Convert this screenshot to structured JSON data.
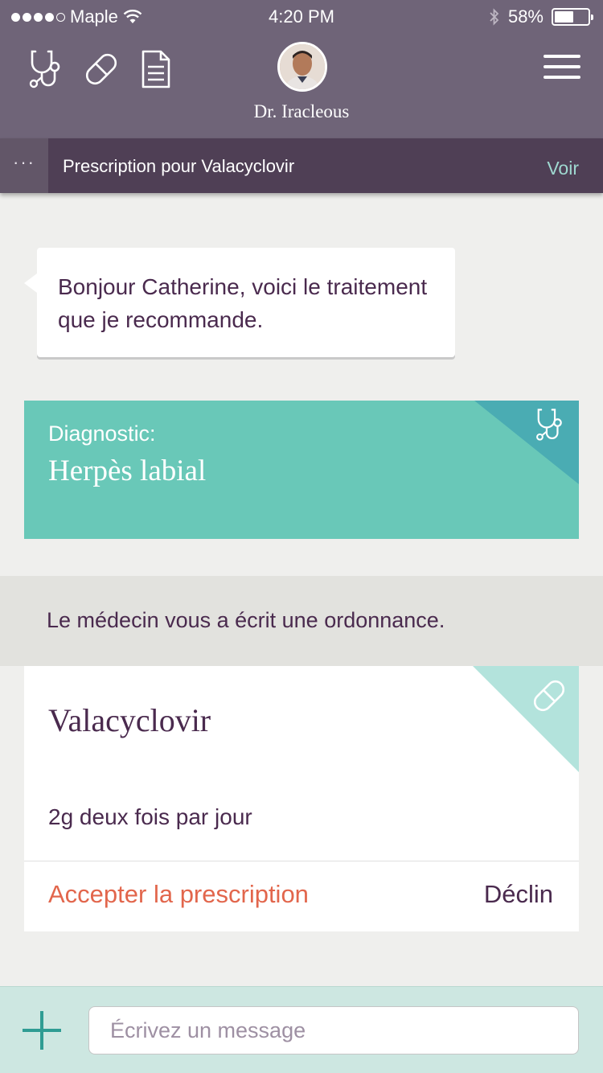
{
  "status_bar": {
    "carrier": "Maple",
    "time": "4:20 PM",
    "battery_percent": "58%",
    "battery_level": 0.58,
    "signal_bars_filled": 4
  },
  "header": {
    "doctor_name": "Dr. Iracleous",
    "icons": [
      "stethoscope-icon",
      "pill-icon",
      "document-icon",
      "menu-icon"
    ]
  },
  "subheader": {
    "more": "···",
    "title": "Prescription pour Valacyclovir",
    "action": "Voir"
  },
  "message": {
    "text": "Bonjour Catherine, voici le traitement que je recommande."
  },
  "diagnostic": {
    "label": "Diagnostic:",
    "value": "Herpès labial"
  },
  "notice": {
    "text": "Le médecin vous a écrit une ordonnance."
  },
  "prescription": {
    "drug": "Valacyclovir",
    "dosage": "2g deux fois par jour",
    "accept_label": "Accepter la prescription",
    "decline_label": "Déclin"
  },
  "composer": {
    "placeholder": "Écrivez un message"
  },
  "colors": {
    "header_bg": "#6f6478",
    "subheader_bg": "#4f3f55",
    "diagnostic_bg": "#69c8b8",
    "accept_color": "#e2664c",
    "composer_bg": "#cde7e1"
  }
}
